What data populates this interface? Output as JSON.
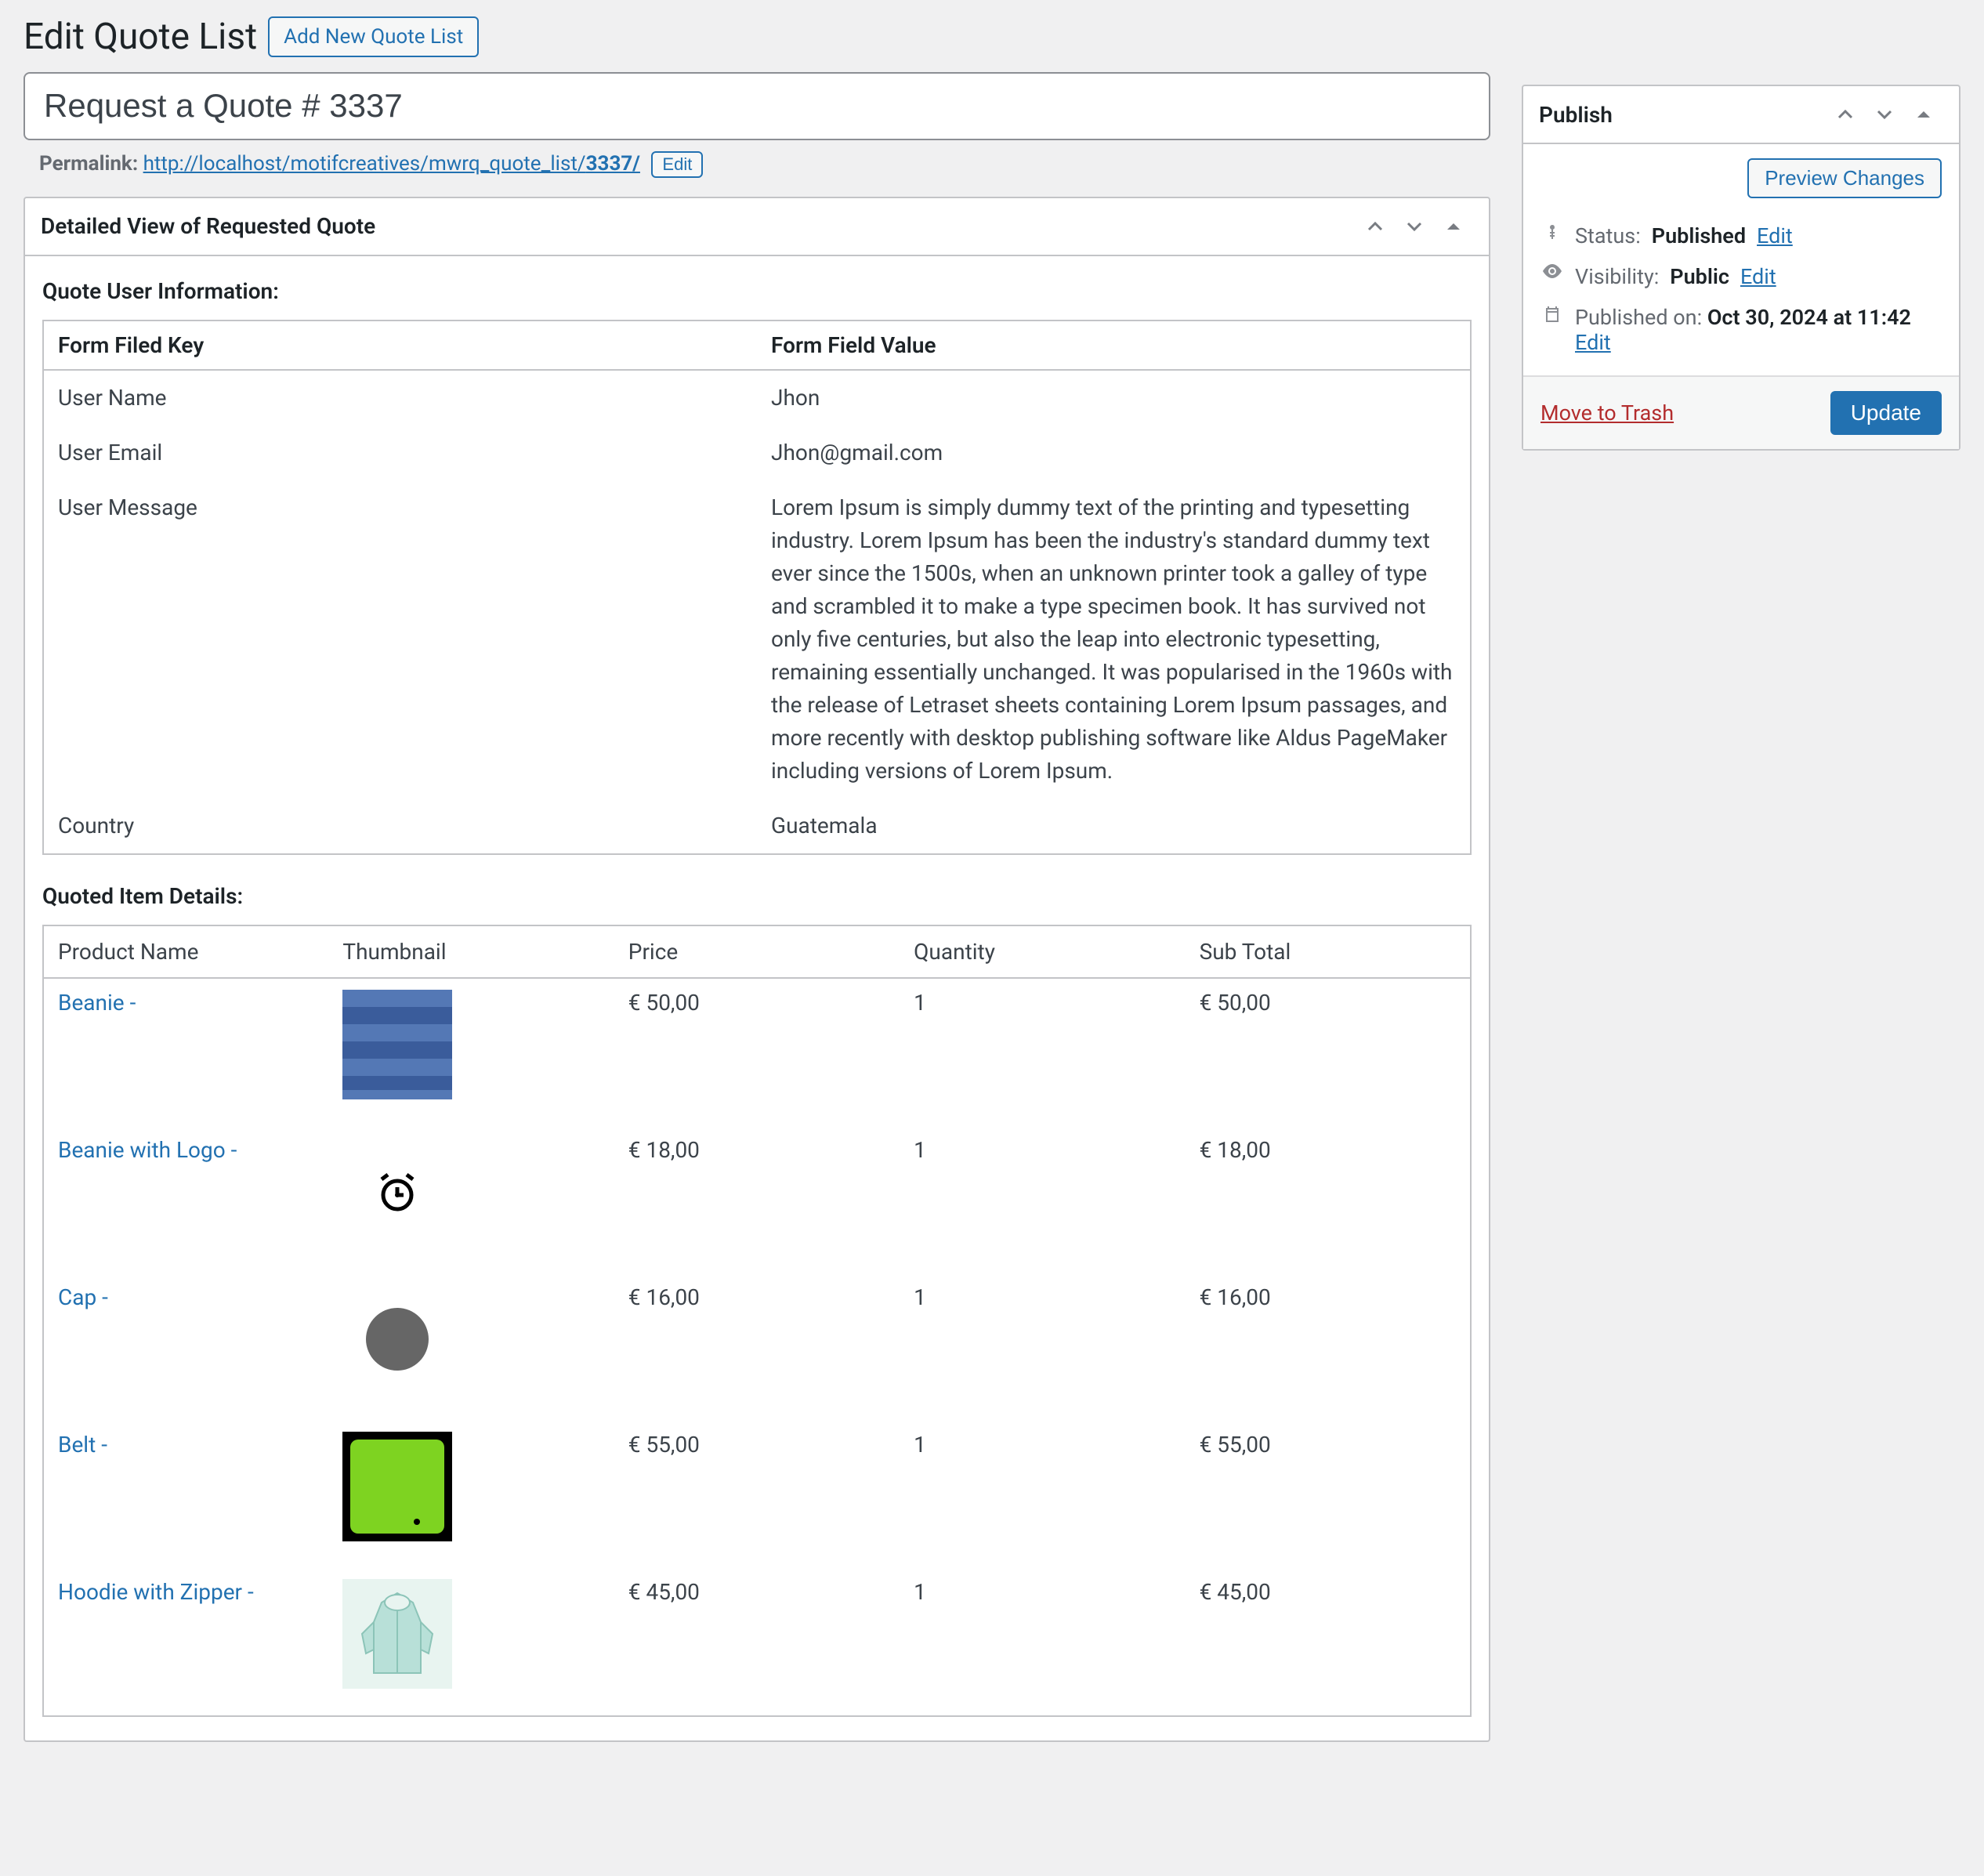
{
  "page": {
    "title": "Edit Quote List",
    "add_new": "Add New Quote List"
  },
  "post": {
    "title": "Request a Quote # 3337",
    "permalink_label": "Permalink:",
    "permalink_base": "http://localhost/motifcreatives/mwrq_quote_list/",
    "permalink_slug": "3337/",
    "edit_slug": "Edit"
  },
  "metabox": {
    "title": "Detailed View of Requested Quote",
    "user_info_heading": "Quote User Information:",
    "columns": {
      "key": "Form Filed Key",
      "value": "Form Field Value"
    },
    "user_rows": [
      {
        "key": "User Name",
        "value": "Jhon"
      },
      {
        "key": "User Email",
        "value": "Jhon@gmail.com"
      },
      {
        "key": "User Message",
        "value": "Lorem Ipsum is simply dummy text of the printing and typesetting industry. Lorem Ipsum has been the industry's standard dummy text ever since the 1500s, when an unknown printer took a galley of type and scrambled it to make a type specimen book. It has survived not only five centuries, but also the leap into electronic typesetting, remaining essentially unchanged. It was popularised in the 1960s with the release of Letraset sheets containing Lorem Ipsum passages, and more recently with desktop publishing software like Aldus PageMaker including versions of Lorem Ipsum."
      },
      {
        "key": "Country",
        "value": "Guatemala"
      }
    ],
    "items_heading": "Quoted Item Details:",
    "item_columns": {
      "name": "Product Name",
      "thumb": "Thumbnail",
      "price": "Price",
      "qty": "Quantity",
      "subtotal": "Sub Total"
    },
    "items": [
      {
        "name": "Beanie -",
        "thumb": "stripes",
        "price": "€ 50,00",
        "qty": "1",
        "subtotal": "€ 50,00"
      },
      {
        "name": "Beanie with Logo -",
        "thumb": "alarm",
        "price": "€ 18,00",
        "qty": "1",
        "subtotal": "€ 18,00"
      },
      {
        "name": "Cap -",
        "thumb": "circle",
        "price": "€ 16,00",
        "qty": "1",
        "subtotal": "€ 16,00"
      },
      {
        "name": "Belt -",
        "thumb": "green",
        "price": "€ 55,00",
        "qty": "1",
        "subtotal": "€ 55,00"
      },
      {
        "name": "Hoodie with Zipper -",
        "thumb": "hoodie",
        "price": "€ 45,00",
        "qty": "1",
        "subtotal": "€ 45,00"
      }
    ]
  },
  "publish": {
    "heading": "Publish",
    "preview": "Preview Changes",
    "status_label": "Status:",
    "status_value": "Published",
    "visibility_label": "Visibility:",
    "visibility_value": "Public",
    "published_label": "Published on:",
    "published_value": "Oct 30, 2024 at 11:42",
    "edit": "Edit",
    "trash": "Move to Trash",
    "update": "Update"
  }
}
